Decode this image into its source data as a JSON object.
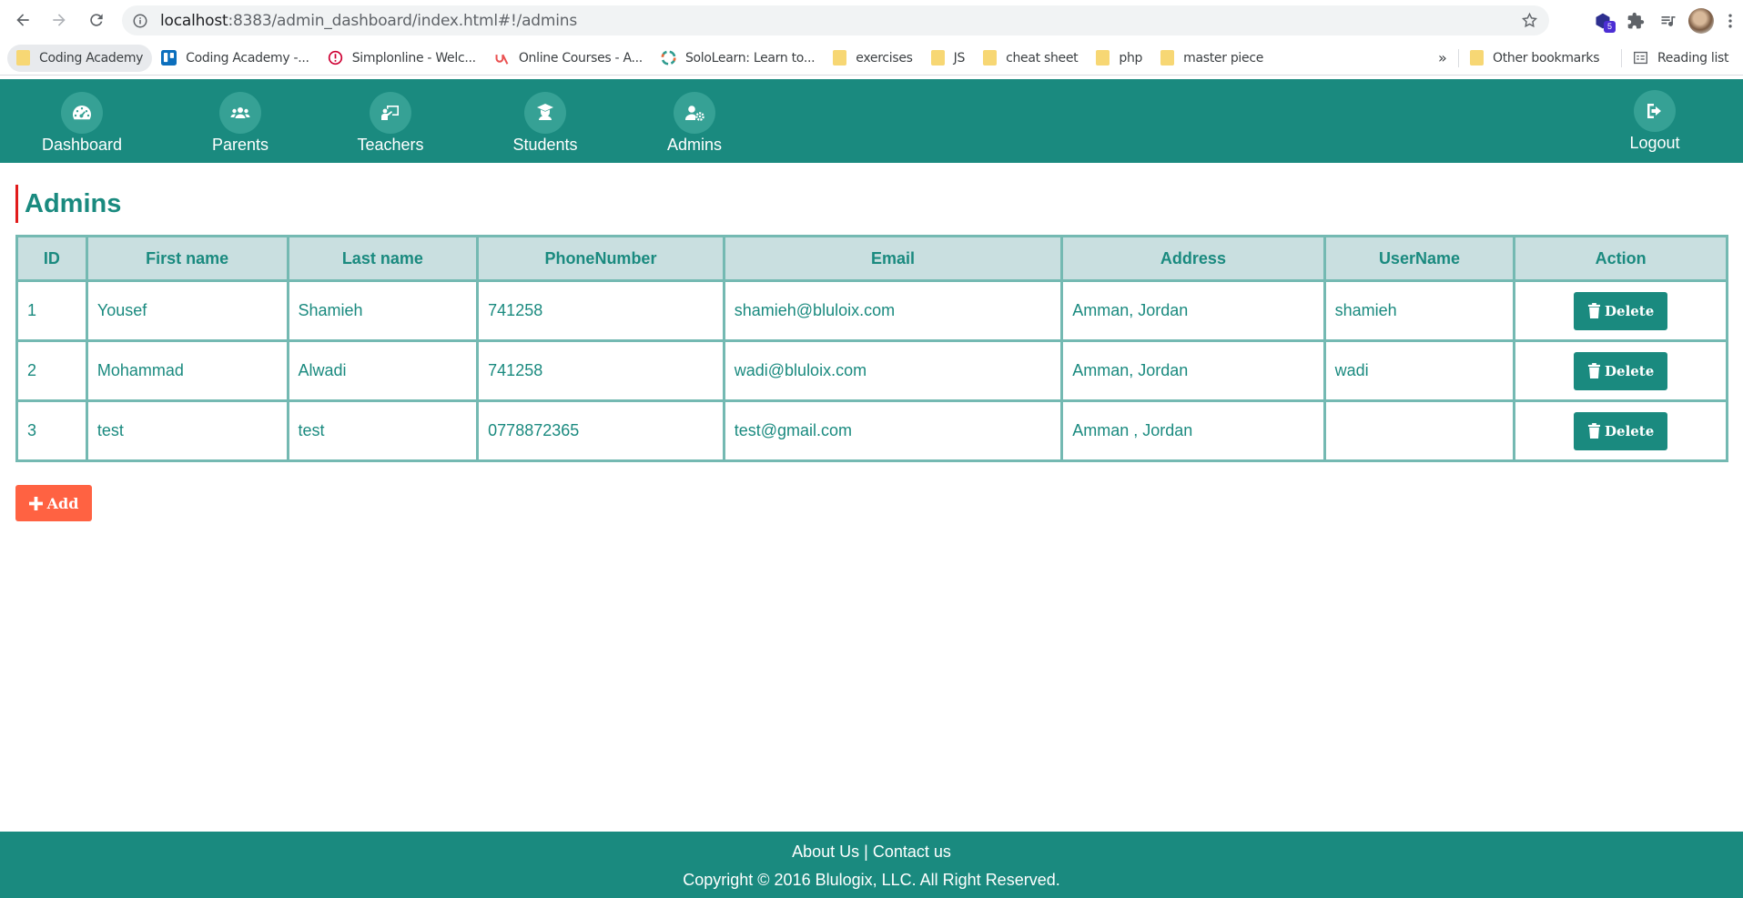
{
  "browser": {
    "url_host": "localhost",
    "url_rest": ":8383/admin_dashboard/index.html#!/admins",
    "extension_badge": "5",
    "bookmarks": [
      {
        "label": "Coding Academy",
        "icon": "folder-icon"
      },
      {
        "label": "Coding Academy -...",
        "icon": "trello-icon"
      },
      {
        "label": "Simplonline - Welc...",
        "icon": "simplon-icon"
      },
      {
        "label": "Online Courses - A...",
        "icon": "udemy-icon"
      },
      {
        "label": "SoloLearn: Learn to...",
        "icon": "sololearn-icon"
      },
      {
        "label": "exercises",
        "icon": "folder-icon"
      },
      {
        "label": "JS",
        "icon": "folder-icon"
      },
      {
        "label": "cheat sheet",
        "icon": "folder-icon"
      },
      {
        "label": "php",
        "icon": "folder-icon"
      },
      {
        "label": "master piece",
        "icon": "folder-icon"
      }
    ],
    "more_bookmarks": "»",
    "other_bookmarks": "Other bookmarks",
    "reading_list": "Reading list"
  },
  "nav": {
    "items": [
      {
        "label": "Dashboard",
        "icon": "dashboard-icon"
      },
      {
        "label": "Parents",
        "icon": "users-icon"
      },
      {
        "label": "Teachers",
        "icon": "teacher-icon"
      },
      {
        "label": "Students",
        "icon": "graduate-icon"
      },
      {
        "label": "Admins",
        "icon": "user-cog-icon"
      }
    ],
    "logout": "Logout"
  },
  "page": {
    "title": "Admins"
  },
  "table": {
    "headers": [
      "ID",
      "First name",
      "Last name",
      "PhoneNumber",
      "Email",
      "Address",
      "UserName",
      "Action"
    ],
    "rows": [
      {
        "id": "1",
        "first": "Yousef",
        "last": "Shamieh",
        "phone": "741258",
        "email": "shamieh@bluloix.com",
        "address": "Amman, Jordan",
        "username": "shamieh"
      },
      {
        "id": "2",
        "first": "Mohammad",
        "last": "Alwadi",
        "phone": "741258",
        "email": "wadi@bluloix.com",
        "address": "Amman, Jordan",
        "username": "wadi"
      },
      {
        "id": "3",
        "first": "test",
        "last": "test",
        "phone": "0778872365",
        "email": "test@gmail.com",
        "address": "Amman , Jordan",
        "username": ""
      }
    ],
    "delete_label": "Delete"
  },
  "add_label": "Add",
  "footer": {
    "about": "About Us",
    "separator": "|",
    "contact": "Contact us",
    "copyright": "Copyright © 2016 Blulogix, LLC. All Right Reserved."
  },
  "colors": {
    "primary": "#1a8a7f",
    "header_bg": "#c9dfe0",
    "border": "#74b9b2",
    "add_button": "#ff6242",
    "title_accent": "#e11b1b"
  }
}
